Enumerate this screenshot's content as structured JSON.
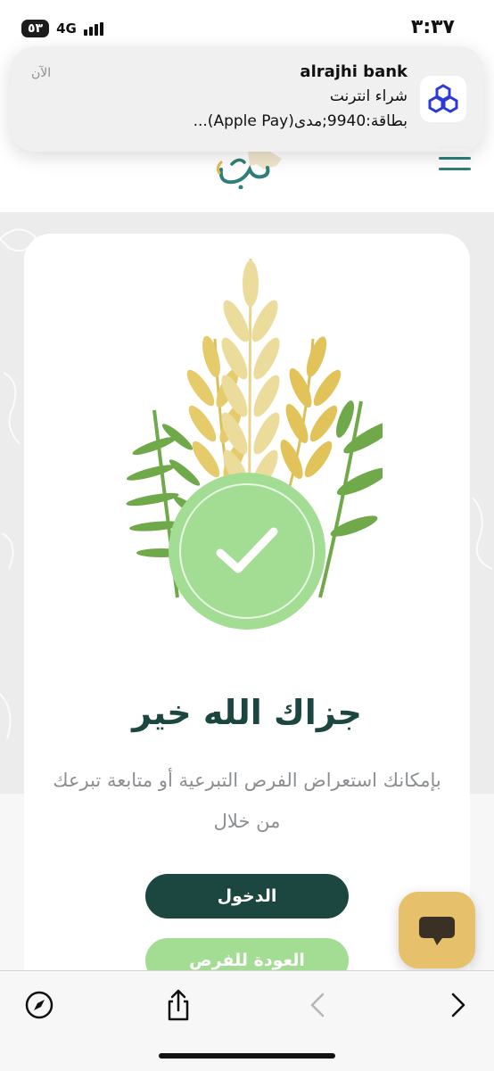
{
  "status_bar": {
    "time": "٣:٣٧",
    "battery": "٥٣",
    "network": "4G"
  },
  "notification": {
    "app_name": "alrajhi bank",
    "line1": "شراء انترنت",
    "line2": "بطاقة:9940;مدى(Apple Pay)...",
    "time": "الآن",
    "icon": "alrajhi-logo-icon"
  },
  "header": {
    "logo_text": "برح",
    "menu_icon": "hamburger-icon"
  },
  "card": {
    "title": "جزاك الله خير",
    "subtitle": "بإمكانك استعراض الفرص التبرعية أو متابعة تبرعك من خلال",
    "login_button": "الدخول",
    "back_button": "العودة للفرص",
    "illustration": "wheat-success-illustration",
    "check_icon": "checkmark-icon"
  },
  "chat": {
    "icon": "chat-bubble-icon"
  },
  "browser_toolbar": {
    "icons": [
      "compass-icon",
      "share-icon",
      "back-chevron-icon",
      "forward-chevron-icon"
    ]
  },
  "colors": {
    "primary_dark": "#1c4640",
    "accent_green": "#a3dc93",
    "chat_gold": "#e6c06b",
    "menu_teal": "#2f7e77"
  }
}
